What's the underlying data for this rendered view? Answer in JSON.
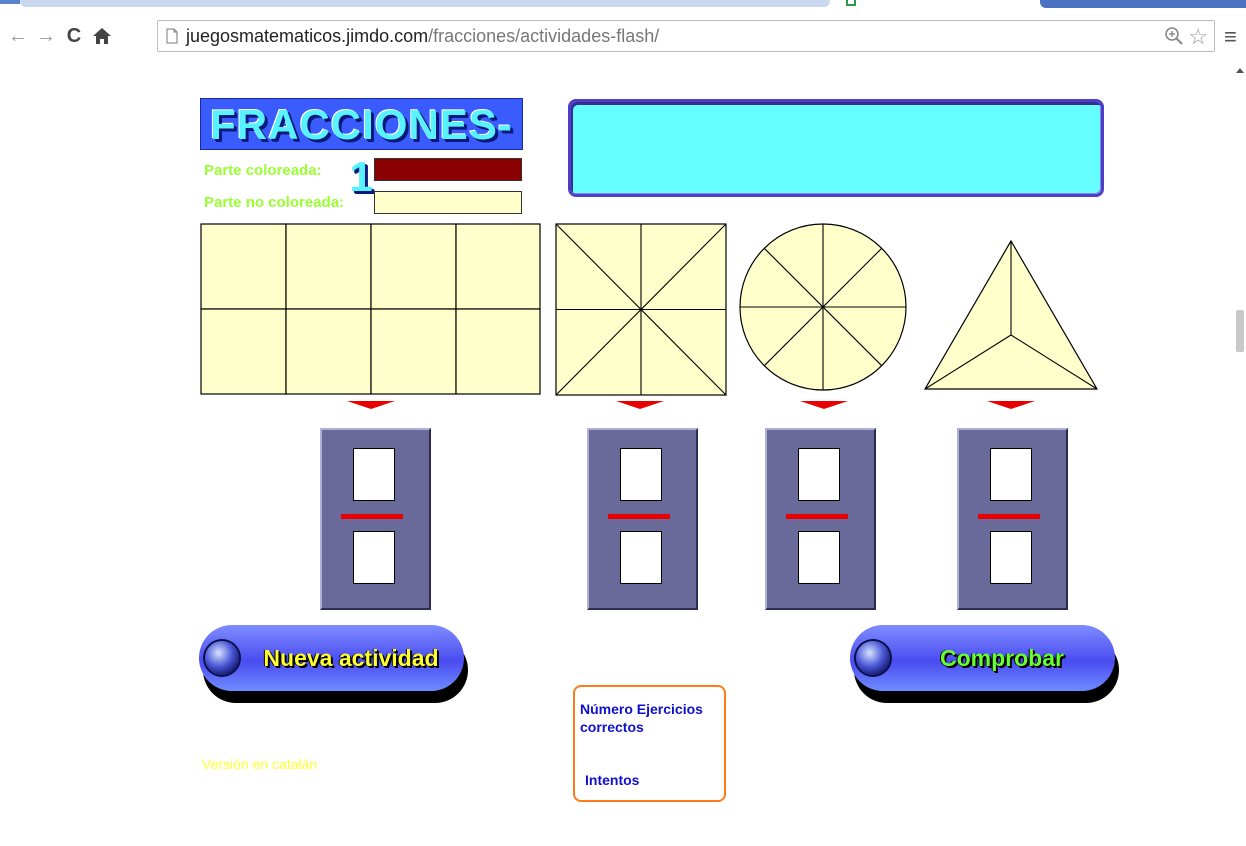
{
  "browser": {
    "url_host": "juegosmatematicos.jimdo.com",
    "url_path": "/fracciones/actividades-flash/",
    "back_icon": "back-arrow-icon",
    "forward_icon": "forward-arrow-icon",
    "reload_icon": "reload-icon",
    "home_icon": "home-icon",
    "zoom_icon": "zoom-icon",
    "bookmark_icon": "star-icon",
    "menu_icon": "hamburger-menu-icon"
  },
  "app": {
    "title": "FRACCIONES-1",
    "legend": {
      "colored_label": "Parte coloreada:",
      "colored_color": "#8b0000",
      "uncolored_label": "Parte no coloreada:",
      "uncolored_color": "#ffffcc"
    },
    "message": "",
    "shapes": [
      {
        "shape": "rectangle-grid",
        "parts": 8
      },
      {
        "shape": "square-diagonals",
        "parts": 8
      },
      {
        "shape": "circle-sectors",
        "parts": 8
      },
      {
        "shape": "triangle-center",
        "parts": 3
      }
    ],
    "buttons": {
      "new_activity": "Nueva actividad",
      "check": "Comprobar"
    },
    "score": {
      "correct_label": "Número Ejercicios correctos",
      "attempts_label": "Intentos"
    },
    "catalan_link": "Versión en catalán",
    "colors": {
      "title_bg": "#3a5cff",
      "message_bg": "#66ffff",
      "panel_bg": "#6a6a9a",
      "fraction_bar": "#e80000",
      "legend_text": "#99ff33",
      "score_border": "#ff7a1a",
      "check_text": "#66ff33",
      "new_activity_text": "#ffff33"
    }
  }
}
